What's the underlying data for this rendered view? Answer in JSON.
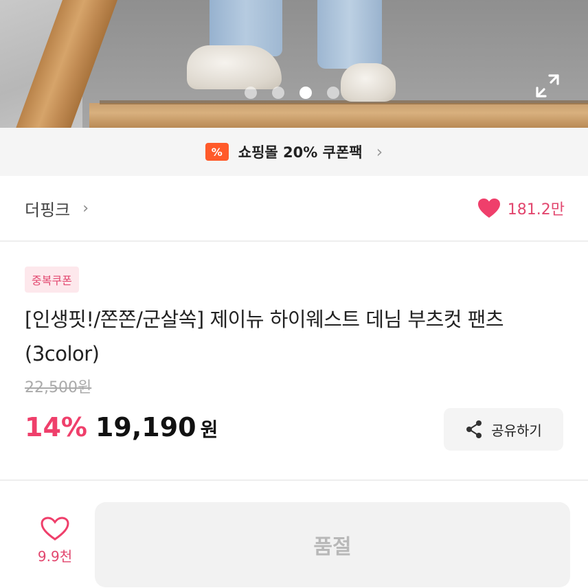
{
  "gallery": {
    "slide_count": 4,
    "active_index": 2
  },
  "coupon_banner": {
    "icon_glyph": "%",
    "text": "쇼핑몰 20% 쿠폰팩",
    "chevron": "›",
    "accent_color": "#ff5a2a"
  },
  "shop": {
    "name": "더핑크",
    "chevron": "›",
    "likes": "181.2만"
  },
  "product": {
    "badge": "중복쿠폰",
    "title": "[인생핏!/쫀쫀/군살쏙] 제이뉴 하이웨스트 데님 부츠컷 팬츠 (3color)",
    "original_price": "22,500원",
    "discount": "14%",
    "price": "19,190",
    "currency": "원"
  },
  "share": {
    "label": "공유하기"
  },
  "bottom_bar": {
    "wish_count": "9.9천",
    "cta_label": "품절"
  },
  "colors": {
    "brand_pink": "#ef3f6b",
    "like_pink": "#e2466e",
    "disabled_gray": "#b8b8b8"
  }
}
